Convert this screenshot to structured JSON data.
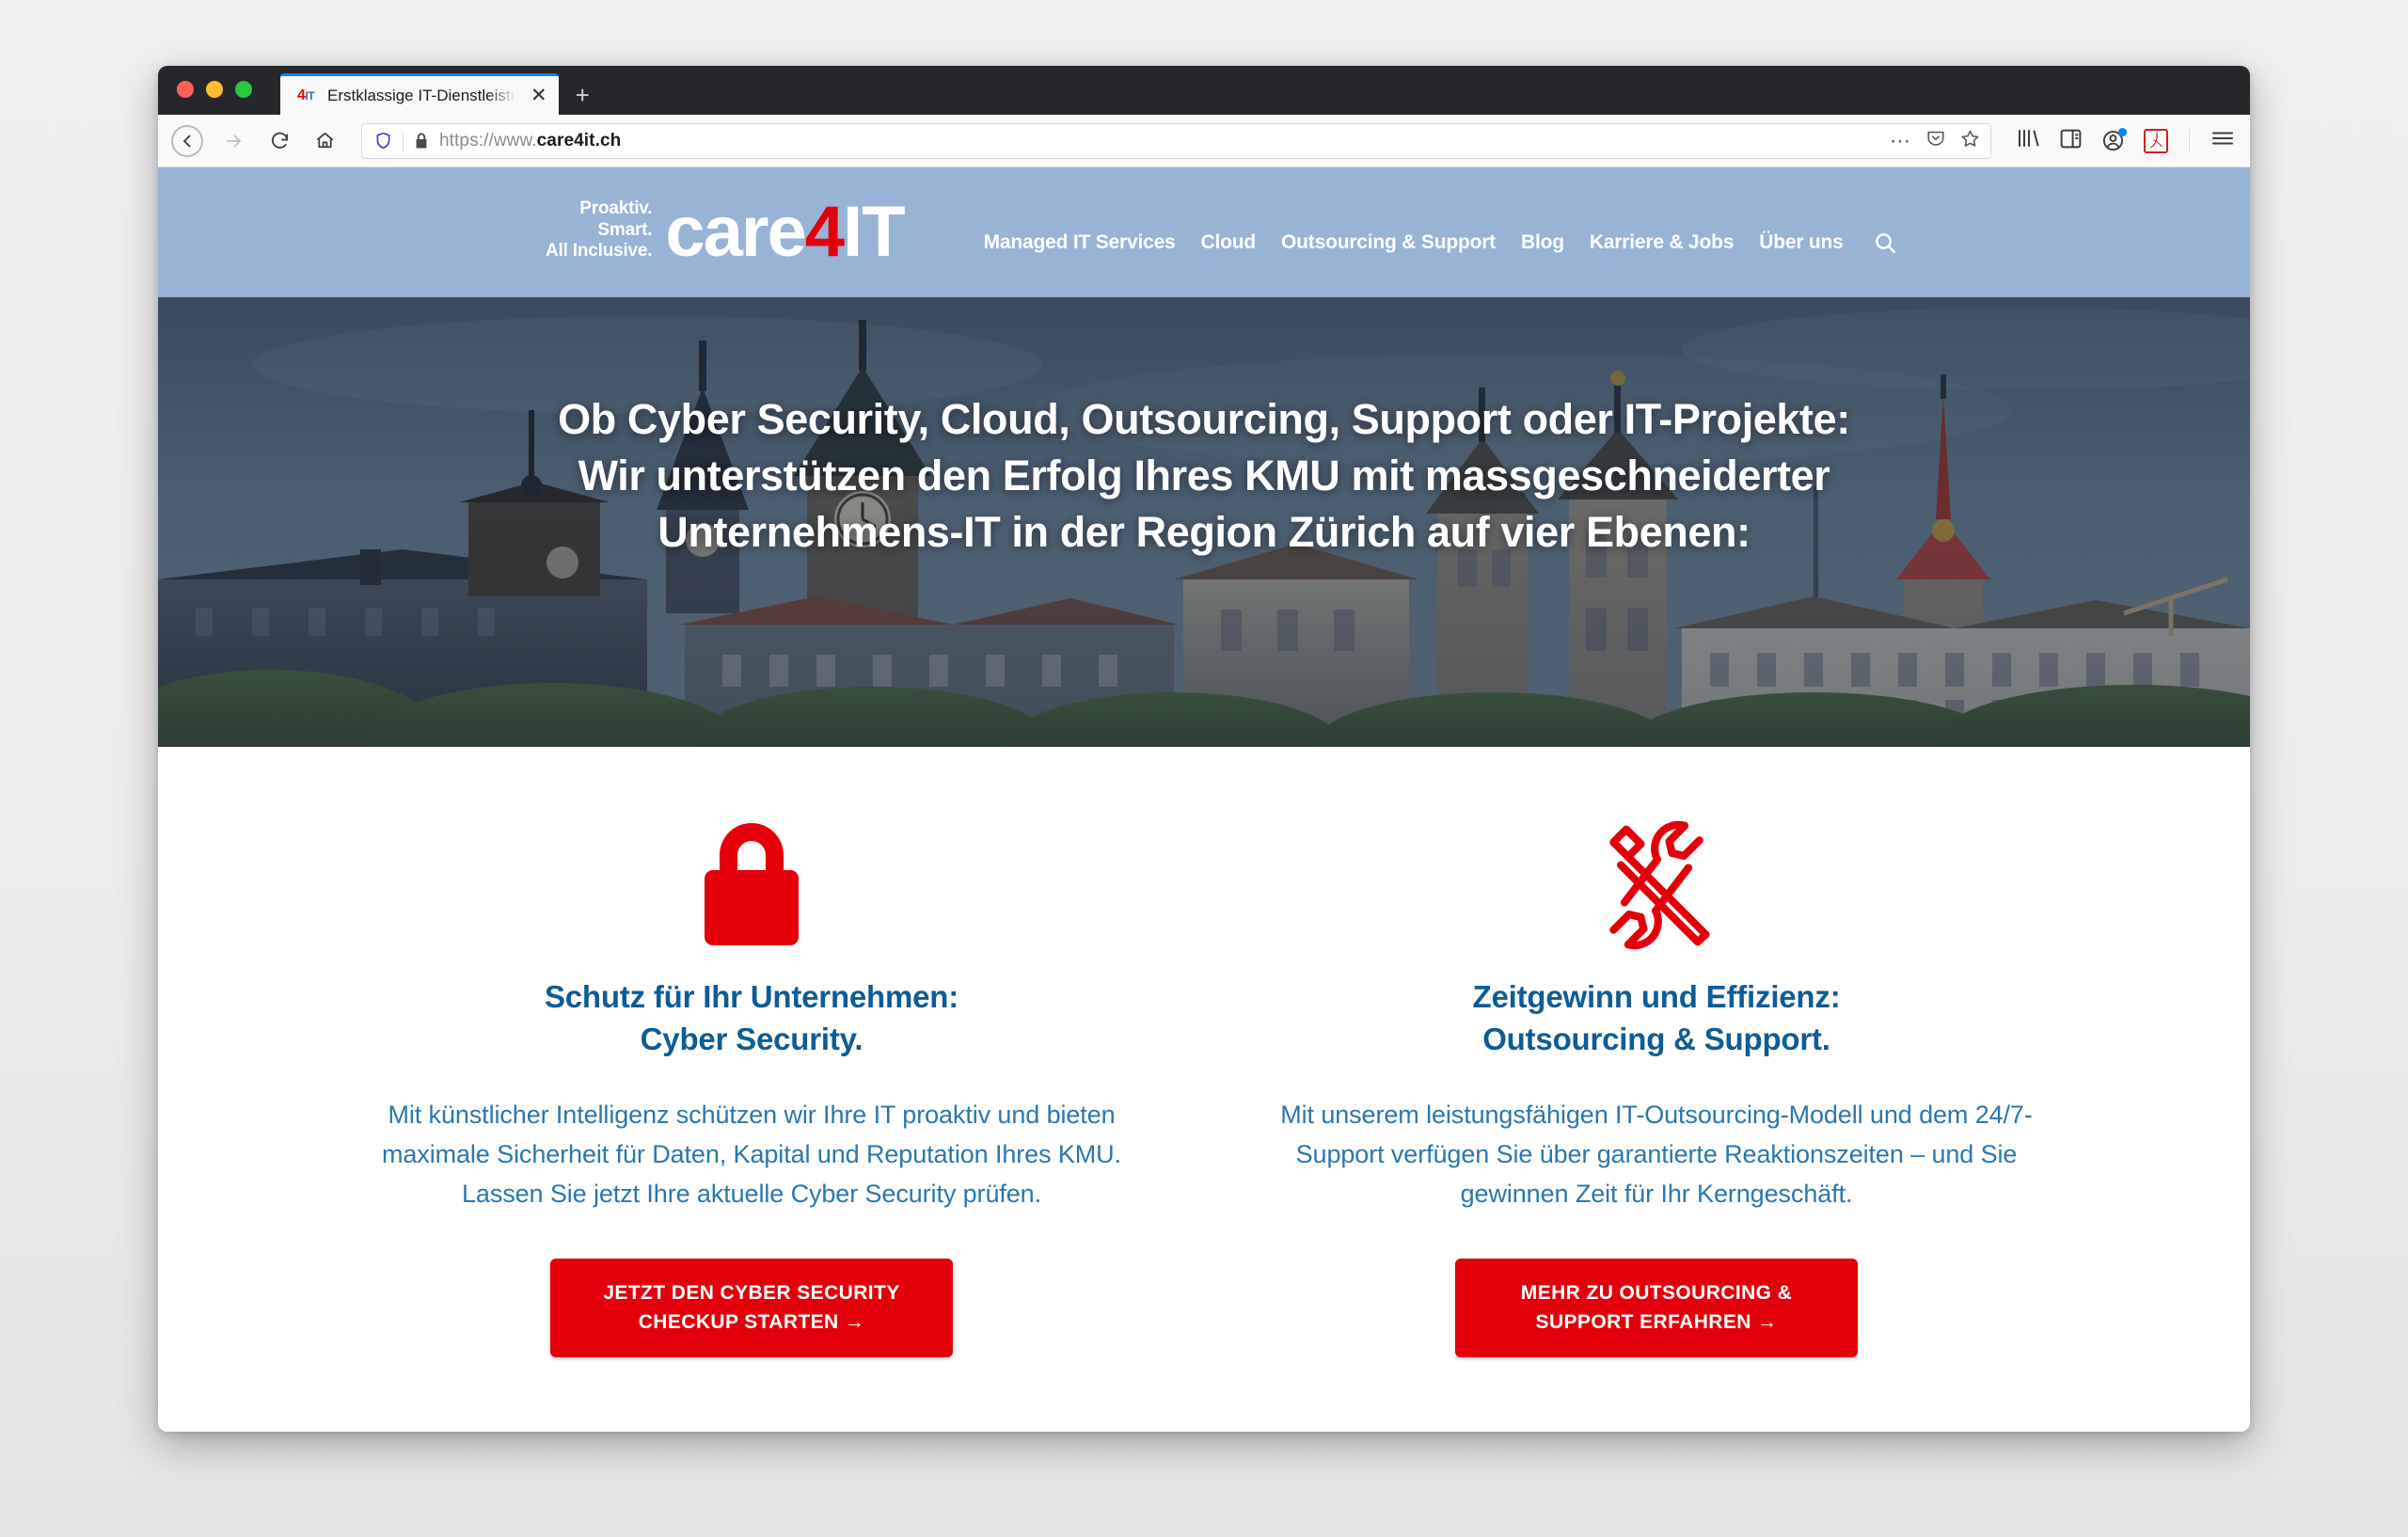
{
  "browser": {
    "tab": {
      "favicon_text_4": "4",
      "favicon_text_it": "IT",
      "title": "Erstklassige IT-Dienstleistungen",
      "close_label": "✕"
    },
    "new_tab_label": "+",
    "toolbar": {
      "back_icon": "back-arrow-icon",
      "forward_icon": "forward-arrow-icon",
      "reload_icon": "reload-icon",
      "home_icon": "home-icon",
      "url_scheme": "https://www.",
      "url_domain": "care4it.ch",
      "url_full": "https://www.care4it.ch",
      "page_actions_label": "⋯",
      "pocket_icon": "pocket-icon",
      "bookmark_icon": "star-icon",
      "library_icon": "library-icon",
      "sidebar_icon": "sidebar-icon",
      "account_icon": "account-icon",
      "pdf_icon": "pdf-extension-icon",
      "menu_icon": "hamburger-menu-icon"
    }
  },
  "site": {
    "header": {
      "tagline": [
        "Proaktiv.",
        "Smart.",
        "All Inclusive."
      ],
      "logo": {
        "word": "care",
        "number": "4",
        "suffix": "IT"
      },
      "nav": [
        {
          "label": "Managed IT Services"
        },
        {
          "label": "Cloud"
        },
        {
          "label": "Outsourcing & Support"
        },
        {
          "label": "Blog"
        },
        {
          "label": "Karriere & Jobs"
        },
        {
          "label": "Über uns"
        }
      ],
      "search_icon": "search-icon",
      "background_color": "#97b4d6"
    },
    "hero": {
      "image_alt": "Zürich skyline with Grossmünster and Fraumünster churches",
      "headline_lines": [
        "Ob Cyber Security, Cloud, Outsourcing, Support oder IT-Projekte:",
        "Wir unterstützen den Erfolg Ihres KMU mit massgeschneiderter",
        "Unternehmens-IT in der Region Zürich auf vier Ebenen:"
      ]
    },
    "cards": [
      {
        "icon": "padlock-icon",
        "icon_color": "#e3000b",
        "title_lines": [
          "Schutz für Ihr Unternehmen:",
          "Cyber Security."
        ],
        "body": "Mit künstlicher Intelligenz schützen wir Ihre IT proaktiv und bieten maximale Sicherheit für Daten, Kapital und Reputation Ihres KMU. Lassen Sie jetzt Ihre aktuelle Cyber Security prüfen.",
        "cta_lines": [
          "JETZT DEN CYBER SECURITY",
          "CHECKUP STARTEN →"
        ]
      },
      {
        "icon": "tools-icon",
        "icon_color": "#e3000b",
        "title_lines": [
          "Zeitgewinn und Effizienz:",
          "Outsourcing & Support."
        ],
        "body": "Mit unserem leistungsfähigen IT-Outsourcing-Modell und dem 24/7-Support verfügen Sie über garantierte Reaktionszeiten – und Sie gewinnen Zeit für Ihr Kerngeschäft.",
        "cta_lines": [
          "MEHR ZU OUTSOURCING &",
          "SUPPORT ERFAHREN →"
        ]
      }
    ],
    "colors": {
      "brand_red": "#e3000b",
      "heading_blue": "#0e5c96",
      "body_blue": "#2a77ad",
      "header_blue": "#97b4d6"
    }
  }
}
